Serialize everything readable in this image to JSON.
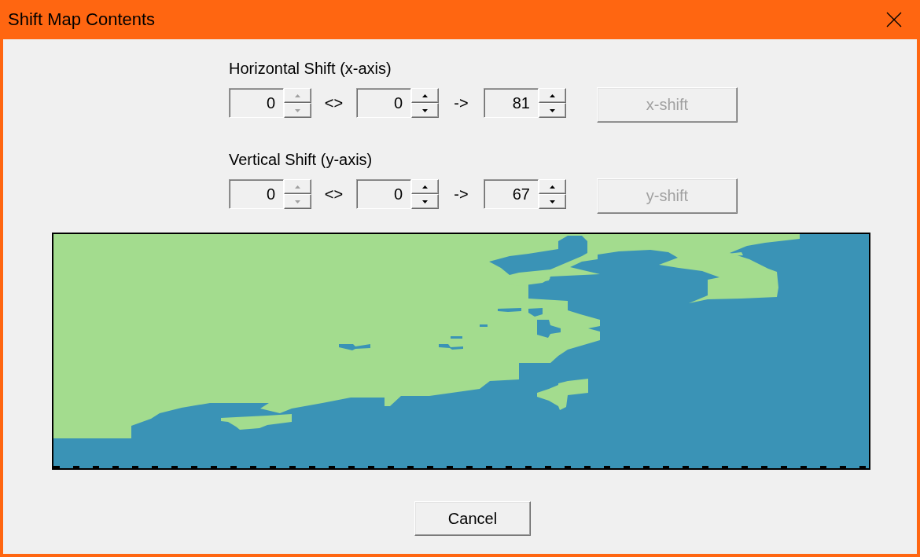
{
  "window": {
    "title": "Shift Map Contents"
  },
  "shift_groups": [
    {
      "label": "Horizontal Shift (x-axis)",
      "spinners": [
        {
          "value": "0",
          "arrows_disabled": true
        },
        {
          "value": "0",
          "arrows_disabled": false
        },
        {
          "value": "81",
          "arrows_disabled": false
        }
      ],
      "separators": [
        "<>",
        "->"
      ],
      "button": {
        "label": "x-shift",
        "disabled": true
      }
    },
    {
      "label": "Vertical Shift (y-axis)",
      "spinners": [
        {
          "value": "0",
          "arrows_disabled": true
        },
        {
          "value": "0",
          "arrows_disabled": false
        },
        {
          "value": "67",
          "arrows_disabled": false
        }
      ],
      "separators": [
        "<>",
        "->"
      ],
      "button": {
        "label": "y-shift",
        "disabled": true
      }
    }
  ],
  "buttons": [
    {
      "label": "Cancel",
      "disabled": false
    }
  ]
}
